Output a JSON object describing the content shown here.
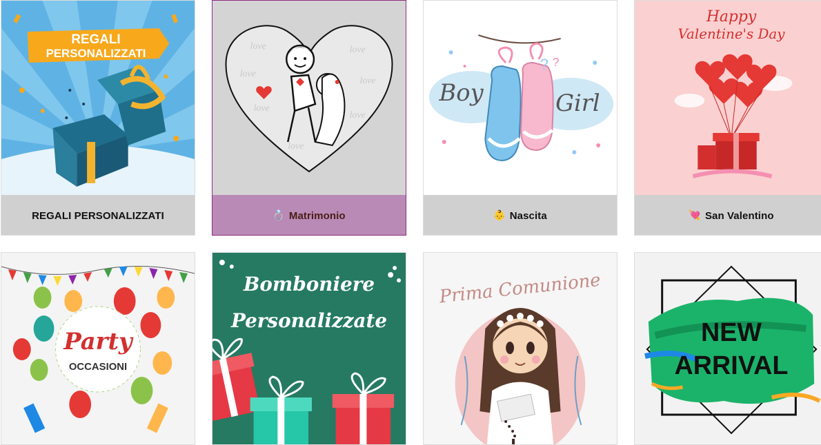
{
  "cards": [
    {
      "label": "REGALI PERSONALIZZATI",
      "emoji": "",
      "art_text": [
        "REGALI",
        "PERSONALIZZATI"
      ],
      "active": false
    },
    {
      "label": "Matrimonio",
      "emoji": "💍",
      "art_text": [
        "love"
      ],
      "active": true
    },
    {
      "label": "Nascita",
      "emoji": "👶",
      "art_text": [
        "Boy",
        "Girl"
      ],
      "active": false
    },
    {
      "label": "San Valentino",
      "emoji": "💘",
      "art_text": [
        "Happy",
        "Valentine's Day"
      ],
      "active": false
    },
    {
      "label": "",
      "art_text": [
        "Party",
        "OCCASIONI"
      ]
    },
    {
      "label": "",
      "art_text": [
        "Bomboniere",
        "Personalizzate"
      ]
    },
    {
      "label": "",
      "art_text": [
        "Prima Comunione"
      ]
    },
    {
      "label": "",
      "art_text": [
        "NEW",
        "ARRIVAL"
      ]
    }
  ],
  "colors": {
    "label_bar": "#d0d0d0",
    "label_bar_active": "#b98ab6",
    "active_border": "#8e2b82",
    "active_text": "#4a1d14"
  }
}
